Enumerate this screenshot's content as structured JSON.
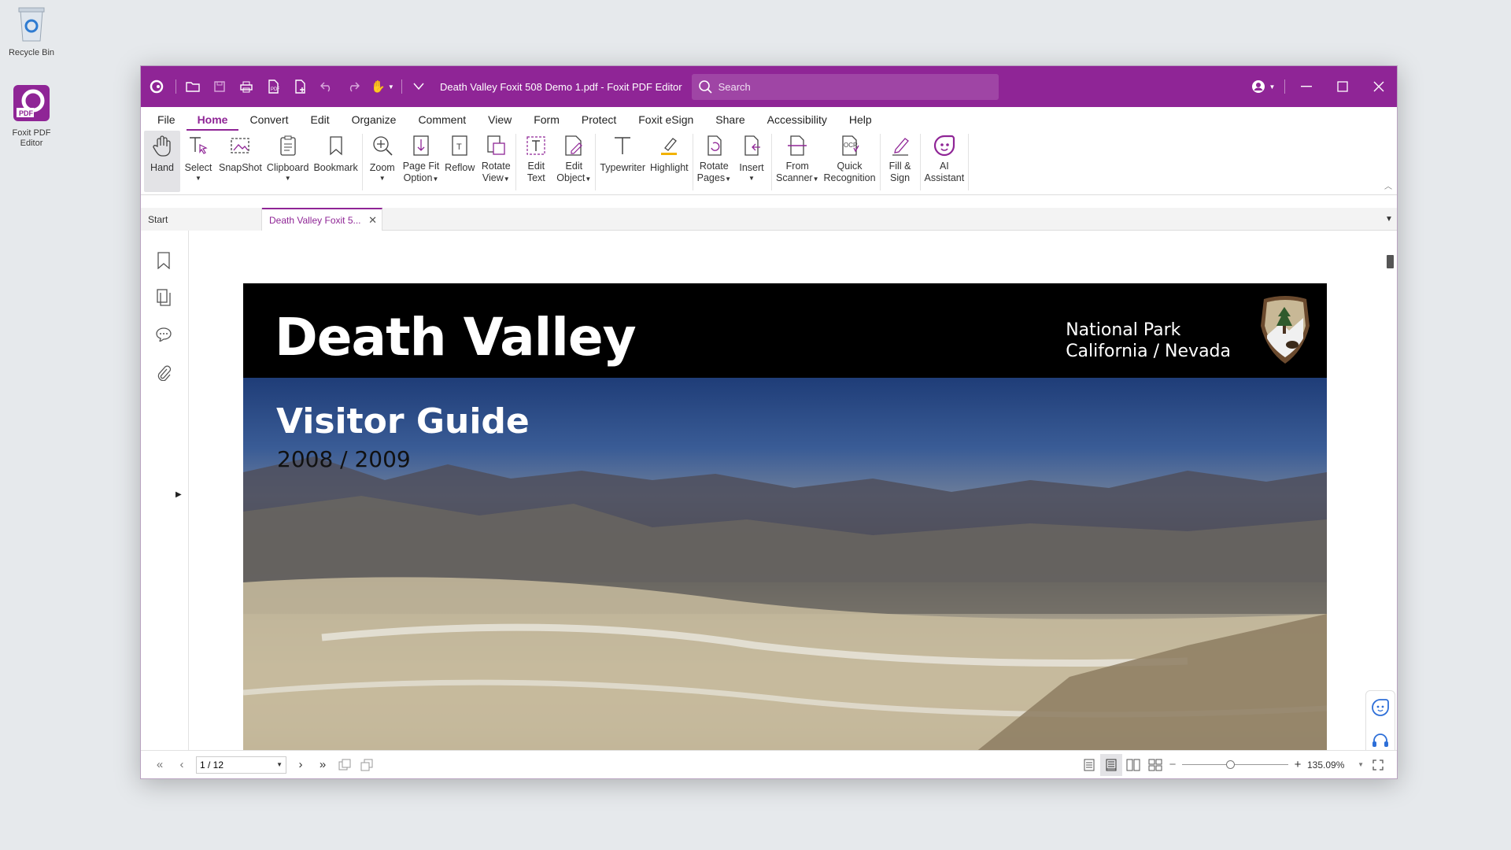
{
  "desktop": {
    "recycle_bin": "Recycle Bin",
    "foxit_shortcut": "Foxit PDF Editor"
  },
  "titlebar": {
    "title": "Death Valley Foxit 508 Demo 1.pdf - Foxit PDF Editor",
    "search_placeholder": "Search",
    "accent_color": "#8f2596"
  },
  "menu": [
    "File",
    "Home",
    "Convert",
    "Edit",
    "Organize",
    "Comment",
    "View",
    "Form",
    "Protect",
    "Foxit eSign",
    "Share",
    "Accessibility",
    "Help"
  ],
  "menu_active": "Home",
  "ribbon": {
    "hand": "Hand",
    "select": "Select",
    "snapshot": "SnapShot",
    "clipboard": "Clipboard",
    "bookmark": "Bookmark",
    "zoom": "Zoom",
    "page_fit_1": "Page Fit",
    "page_fit_2": "Option",
    "reflow": "Reflow",
    "rotate_view_1": "Rotate",
    "rotate_view_2": "View",
    "edit_text_1": "Edit",
    "edit_text_2": "Text",
    "edit_object_1": "Edit",
    "edit_object_2": "Object",
    "typewriter": "Typewriter",
    "highlight": "Highlight",
    "rotate_pages_1": "Rotate",
    "rotate_pages_2": "Pages",
    "insert": "Insert",
    "from_scanner_1": "From",
    "from_scanner_2": "Scanner",
    "quick_recog_1": "Quick",
    "quick_recog_2": "Recognition",
    "fill_sign_1": "Fill &",
    "fill_sign_2": "Sign",
    "ai_1": "AI",
    "ai_2": "Assistant"
  },
  "tabs": {
    "start": "Start",
    "document": "Death Valley Foxit 5..."
  },
  "page": {
    "title": "Death Valley",
    "np_line1": "National Park",
    "np_line2": "California / Nevada",
    "subtitle": "Visitor Guide",
    "years": "2008 / 2009"
  },
  "statusbar": {
    "page_value": "1 / 12",
    "zoom": "135.09%",
    "zoom_level": 0.45
  }
}
